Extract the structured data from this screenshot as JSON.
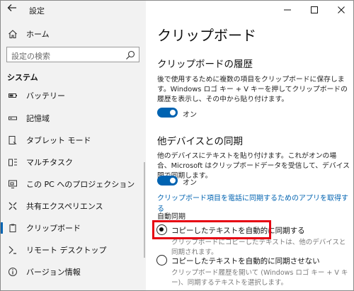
{
  "window": {
    "app_title": "設定",
    "back_icon": "back-arrow-icon"
  },
  "sidebar": {
    "home": {
      "label": "ホーム",
      "icon": "home-icon"
    },
    "search": {
      "placeholder": "設定の検索",
      "icon": "search-icon"
    },
    "section_header": "システム",
    "items": [
      {
        "label": "バッテリー",
        "icon": "battery-icon"
      },
      {
        "label": "記憶域",
        "icon": "storage-icon"
      },
      {
        "label": "タブレット モード",
        "icon": "tablet-mode-icon"
      },
      {
        "label": "マルチタスク",
        "icon": "multitasking-icon"
      },
      {
        "label": "この PC へのプロジェクション",
        "icon": "projection-icon"
      },
      {
        "label": "共有エクスペリエンス",
        "icon": "shared-experiences-icon"
      },
      {
        "label": "クリップボード",
        "icon": "clipboard-icon",
        "active": true
      },
      {
        "label": "リモート デスクトップ",
        "icon": "remote-desktop-icon"
      },
      {
        "label": "バージョン情報",
        "icon": "info-icon"
      }
    ]
  },
  "content": {
    "title": "クリップボード",
    "history": {
      "heading": "クリップボードの履歴",
      "description": "後で使用するために複数の項目をクリップボードに保存します。Windows ロゴ キー + V キーを押してクリップボードの履歴を表示し、その中から貼り付けます。",
      "toggle_label": "オン",
      "toggle_on": true
    },
    "sync": {
      "heading": "他デバイスとの同期",
      "description": "他のデバイスにテキストを貼り付けます。これがオンの場合、Microsoft はクリップボードデータを受信して、デバイス間で同期します。",
      "toggle_label": "オン",
      "toggle_on": true,
      "link": "クリップボード項目を電話に同期するためのアプリを取得する",
      "auto_sync_label": "自動同期",
      "options": [
        {
          "label": "コピーしたテキストを自動的に同期する",
          "description": "クリップボードにコピーしたテキストは、他のデバイスと同期されます。",
          "selected": true
        },
        {
          "label": "コピーしたテキストを自動的に同期させない",
          "description": "クリップボード履歴を開いて (Windows ロゴ キー + V キー)、同期するテキストを選択します。",
          "selected": false
        }
      ]
    }
  },
  "colors": {
    "accent": "#0063b1",
    "highlight": "#e60012",
    "sidebar_bg": "#f2f2f2"
  }
}
